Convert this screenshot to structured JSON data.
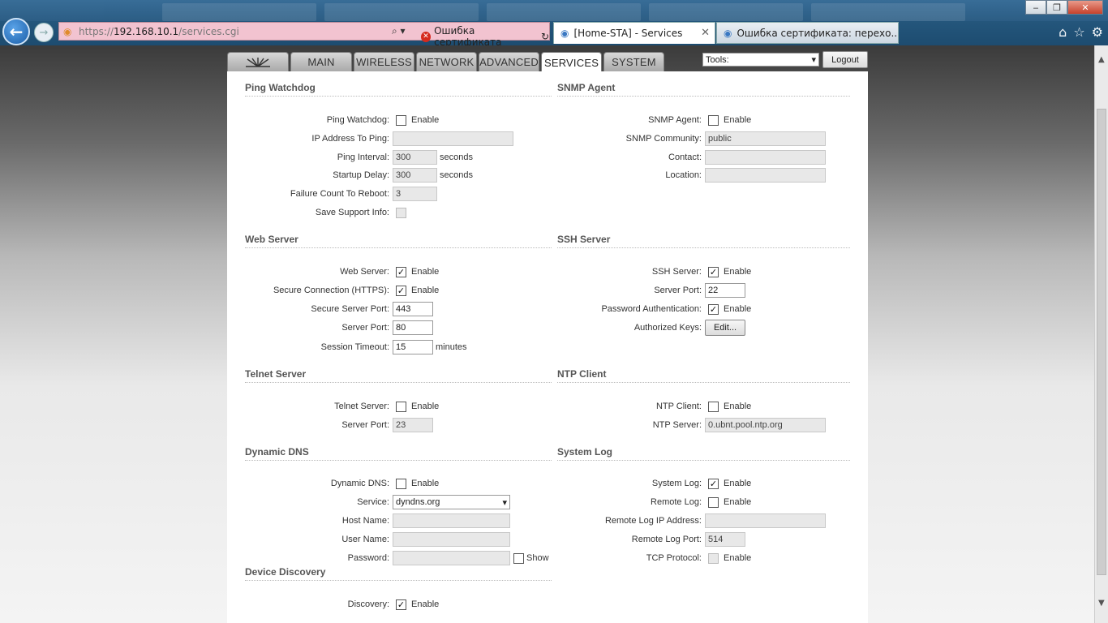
{
  "browser": {
    "url_proto": "https://",
    "url_host": "192.168.10.1",
    "url_path": "/services.cgi",
    "cert_error": "Ошибка сертификата",
    "tab_active": "[Home-STA] - Services",
    "tab_other": "Ошибка сертификата: перехо..."
  },
  "nav": {
    "tabs": [
      "MAIN",
      "WIRELESS",
      "NETWORK",
      "ADVANCED",
      "SERVICES",
      "SYSTEM"
    ],
    "tools_label": "Tools:",
    "logout": "Logout"
  },
  "ping": {
    "title": "Ping Watchdog",
    "watchdog_label": "Ping Watchdog:",
    "ip_label": "IP Address To Ping:",
    "interval_label": "Ping Interval:",
    "interval": "300",
    "delay_label": "Startup Delay:",
    "delay": "300",
    "failure_label": "Failure Count To Reboot:",
    "failure": "3",
    "support_label": "Save Support Info:",
    "seconds": "seconds"
  },
  "snmp": {
    "title": "SNMP Agent",
    "agent_label": "SNMP Agent:",
    "community_label": "SNMP Community:",
    "community": "public",
    "contact_label": "Contact:",
    "location_label": "Location:"
  },
  "web": {
    "title": "Web Server",
    "server_label": "Web Server:",
    "https_label": "Secure Connection (HTTPS):",
    "secure_port_label": "Secure Server Port:",
    "secure_port": "443",
    "port_label": "Server Port:",
    "port": "80",
    "timeout_label": "Session Timeout:",
    "timeout": "15",
    "minutes": "minutes"
  },
  "ssh": {
    "title": "SSH Server",
    "server_label": "SSH Server:",
    "port_label": "Server Port:",
    "port": "22",
    "pwauth_label": "Password Authentication:",
    "keys_label": "Authorized Keys:",
    "edit": "Edit..."
  },
  "telnet": {
    "title": "Telnet Server",
    "server_label": "Telnet Server:",
    "port_label": "Server Port:",
    "port": "23"
  },
  "ntp": {
    "title": "NTP Client",
    "client_label": "NTP Client:",
    "server_label": "NTP Server:",
    "server": "0.ubnt.pool.ntp.org"
  },
  "ddns": {
    "title": "Dynamic DNS",
    "ddns_label": "Dynamic DNS:",
    "service_label": "Service:",
    "service": "dyndns.org",
    "host_label": "Host Name:",
    "user_label": "User Name:",
    "password_label": "Password:",
    "show": "Show"
  },
  "syslog": {
    "title": "System Log",
    "log_label": "System Log:",
    "remote_label": "Remote Log:",
    "remote_ip_label": "Remote Log IP Address:",
    "remote_port_label": "Remote Log Port:",
    "remote_port": "514",
    "tcp_label": "TCP Protocol:"
  },
  "discovery": {
    "title": "Device Discovery",
    "discovery_label": "Discovery:"
  },
  "common": {
    "enable": "Enable"
  },
  "icons": {
    "check": "✓"
  }
}
